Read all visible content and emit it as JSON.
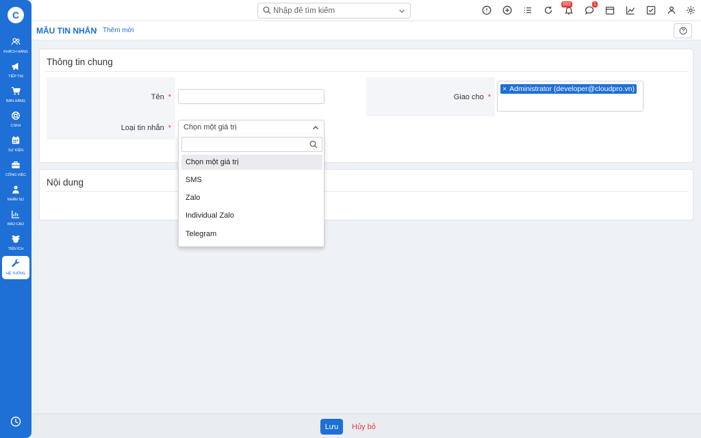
{
  "sidebar": {
    "logo": "C",
    "items": [
      {
        "label": "KHÁCH HÀNG",
        "icon": "users-icon"
      },
      {
        "label": "TIẾP THỊ",
        "icon": "megaphone-icon"
      },
      {
        "label": "BÁN HÀNG",
        "icon": "cart-icon"
      },
      {
        "label": "CSKH",
        "icon": "lifebuoy-icon"
      },
      {
        "label": "SỰ KIỆN",
        "icon": "calendar-icon"
      },
      {
        "label": "CÔNG VIỆC",
        "icon": "briefcase-icon"
      },
      {
        "label": "NHÂN SỰ",
        "icon": "person-icon"
      },
      {
        "label": "BÁO CÁO",
        "icon": "report-icon"
      },
      {
        "label": "TIỆN ÍCH",
        "icon": "box-icon"
      },
      {
        "label": "HỆ THỐNG",
        "icon": "wrench-icon",
        "active": true
      }
    ]
  },
  "topbar": {
    "search_placeholder": "Nhập để tìm kiếm",
    "notification_count": "693",
    "message_count": "1"
  },
  "breadcrumb": {
    "title": "MẪU TIN NHẮN",
    "separator": "›",
    "current": "Thêm mới"
  },
  "general": {
    "title": "Thông tin chung",
    "name_label": "Tên",
    "name_value": "",
    "type_label": "Loại tin nhắn",
    "assign_label": "Giao cho",
    "required_mark": "*",
    "assignee": "Administrator (developer@cloudpro.vn)",
    "tag_remove": "×"
  },
  "select": {
    "value": "Chọn một giá trị",
    "search_value": "",
    "options": [
      "Chọn một giá trị",
      "SMS",
      "Zalo",
      "Individual Zalo",
      "Telegram"
    ],
    "selected_index": 0
  },
  "content": {
    "title": "Nội dung"
  },
  "footer": {
    "save_label": "Lưu",
    "cancel_label": "Hủy bỏ"
  },
  "colors": {
    "primary": "#1e6fd6",
    "danger": "#e53935",
    "background": "#eef1f5"
  }
}
